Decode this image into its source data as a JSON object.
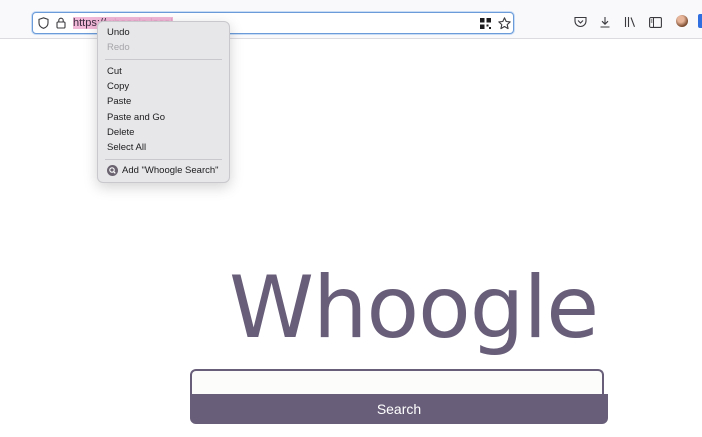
{
  "urlbar": {
    "url_visible": "https://",
    "url_selected": "whoogle.local"
  },
  "menu": {
    "undo": "Undo",
    "redo": "Redo",
    "cut": "Cut",
    "copy": "Copy",
    "paste": "Paste",
    "paste_and_go": "Paste and Go",
    "delete": "Delete",
    "select_all": "Select All",
    "add_search": "Add \"Whoogle Search\""
  },
  "page": {
    "logo": "Whoogle",
    "search_button": "Search",
    "search_value": ""
  },
  "icons": {
    "tracking_protection": "shield-icon",
    "site_security": "lock-icon",
    "extension": "qr-grid-icon",
    "bookmark": "star-icon",
    "pocket": "pocket-icon",
    "downloads": "download-icon",
    "library": "library-icon",
    "sidebar": "sidebar-icon",
    "account": "avatar",
    "search_engine": "magnifier-icon"
  },
  "colors": {
    "brand": "#685e79",
    "selection": "#f2b8d7",
    "focus_ring": "#6b9bd8"
  }
}
